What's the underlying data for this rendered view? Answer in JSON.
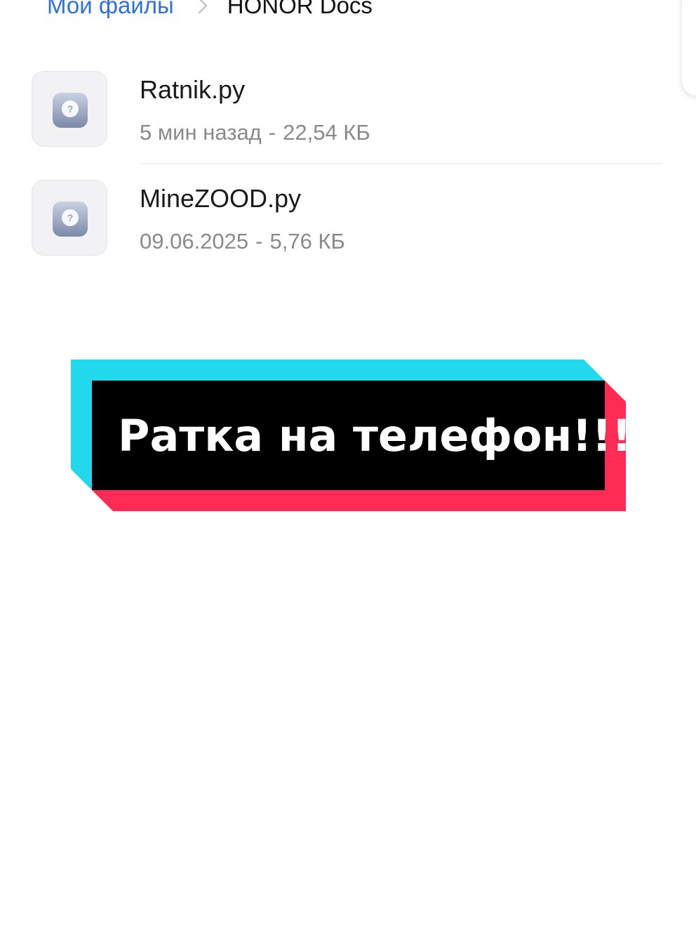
{
  "breadcrumb": {
    "root": "Мои файлы",
    "separator_icon": "chevron-right-icon",
    "current": "HONOR Docs"
  },
  "files": [
    {
      "name": "Ratnik.py",
      "time": "5 мин назад",
      "separator": "-",
      "size": "22,54 КБ",
      "icon": "unknown-file-icon"
    },
    {
      "name": "MineZOOD.py",
      "time": "09.06.2025",
      "separator": "-",
      "size": "5,76 КБ",
      "icon": "unknown-file-icon"
    }
  ],
  "caption": {
    "text": "Ратка на телефон!!!",
    "colors": {
      "cyan": "#22d8eb",
      "red": "#fe2c55",
      "box": "#000000",
      "text": "#ffffff"
    }
  },
  "colors": {
    "link": "#2f6fe0",
    "primary_text": "#1a1a1a",
    "secondary_text": "#8a8a8a"
  }
}
